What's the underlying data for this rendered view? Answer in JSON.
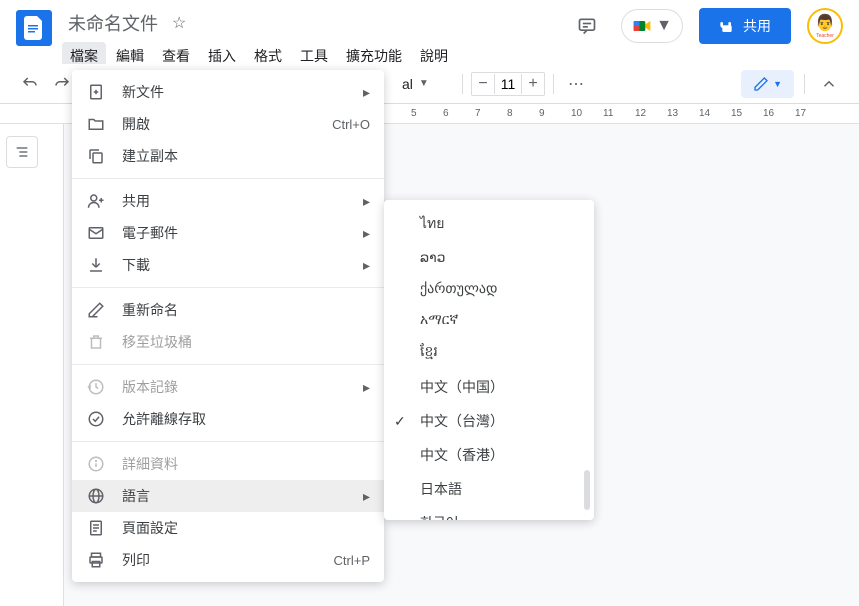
{
  "doc": {
    "title": "未命名文件"
  },
  "menubar": [
    "檔案",
    "編輯",
    "查看",
    "插入",
    "格式",
    "工具",
    "擴充功能",
    "說明"
  ],
  "header": {
    "share": "共用"
  },
  "toolbar": {
    "font": "al",
    "size": "11"
  },
  "ruler": {
    "ticks": [
      "5",
      "6",
      "7",
      "8",
      "9",
      "10",
      "11",
      "12",
      "13",
      "14",
      "15",
      "16",
      "17"
    ]
  },
  "file_menu": [
    {
      "icon": "file-plus",
      "label": "新文件",
      "arrow": true
    },
    {
      "icon": "folder",
      "label": "開啟",
      "shortcut": "Ctrl+O"
    },
    {
      "icon": "copy",
      "label": "建立副本"
    },
    {
      "sep": true
    },
    {
      "icon": "user-plus",
      "label": "共用",
      "arrow": true
    },
    {
      "icon": "mail",
      "label": "電子郵件",
      "arrow": true
    },
    {
      "icon": "download",
      "label": "下載",
      "arrow": true
    },
    {
      "sep": true
    },
    {
      "icon": "rename",
      "label": "重新命名"
    },
    {
      "icon": "trash",
      "label": "移至垃圾桶",
      "disabled": true
    },
    {
      "sep": true
    },
    {
      "icon": "history",
      "label": "版本記錄",
      "arrow": true,
      "disabled": true
    },
    {
      "icon": "offline",
      "label": "允許離線存取"
    },
    {
      "sep": true
    },
    {
      "icon": "info",
      "label": "詳細資料",
      "disabled": true
    },
    {
      "icon": "globe",
      "label": "語言",
      "arrow": true,
      "selected": true
    },
    {
      "icon": "page",
      "label": "頁面設定"
    },
    {
      "icon": "print",
      "label": "列印",
      "shortcut": "Ctrl+P"
    }
  ],
  "lang_menu": [
    {
      "label": "ไทย"
    },
    {
      "label": "ລາວ"
    },
    {
      "label": "ქართულად"
    },
    {
      "label": "አማርኛ"
    },
    {
      "label": "ខ្មែរ"
    },
    {
      "label": "中文（中国）"
    },
    {
      "label": "中文（台灣）",
      "checked": true
    },
    {
      "label": "中文（香港）"
    },
    {
      "label": "日本語"
    },
    {
      "label": "한국어"
    }
  ]
}
